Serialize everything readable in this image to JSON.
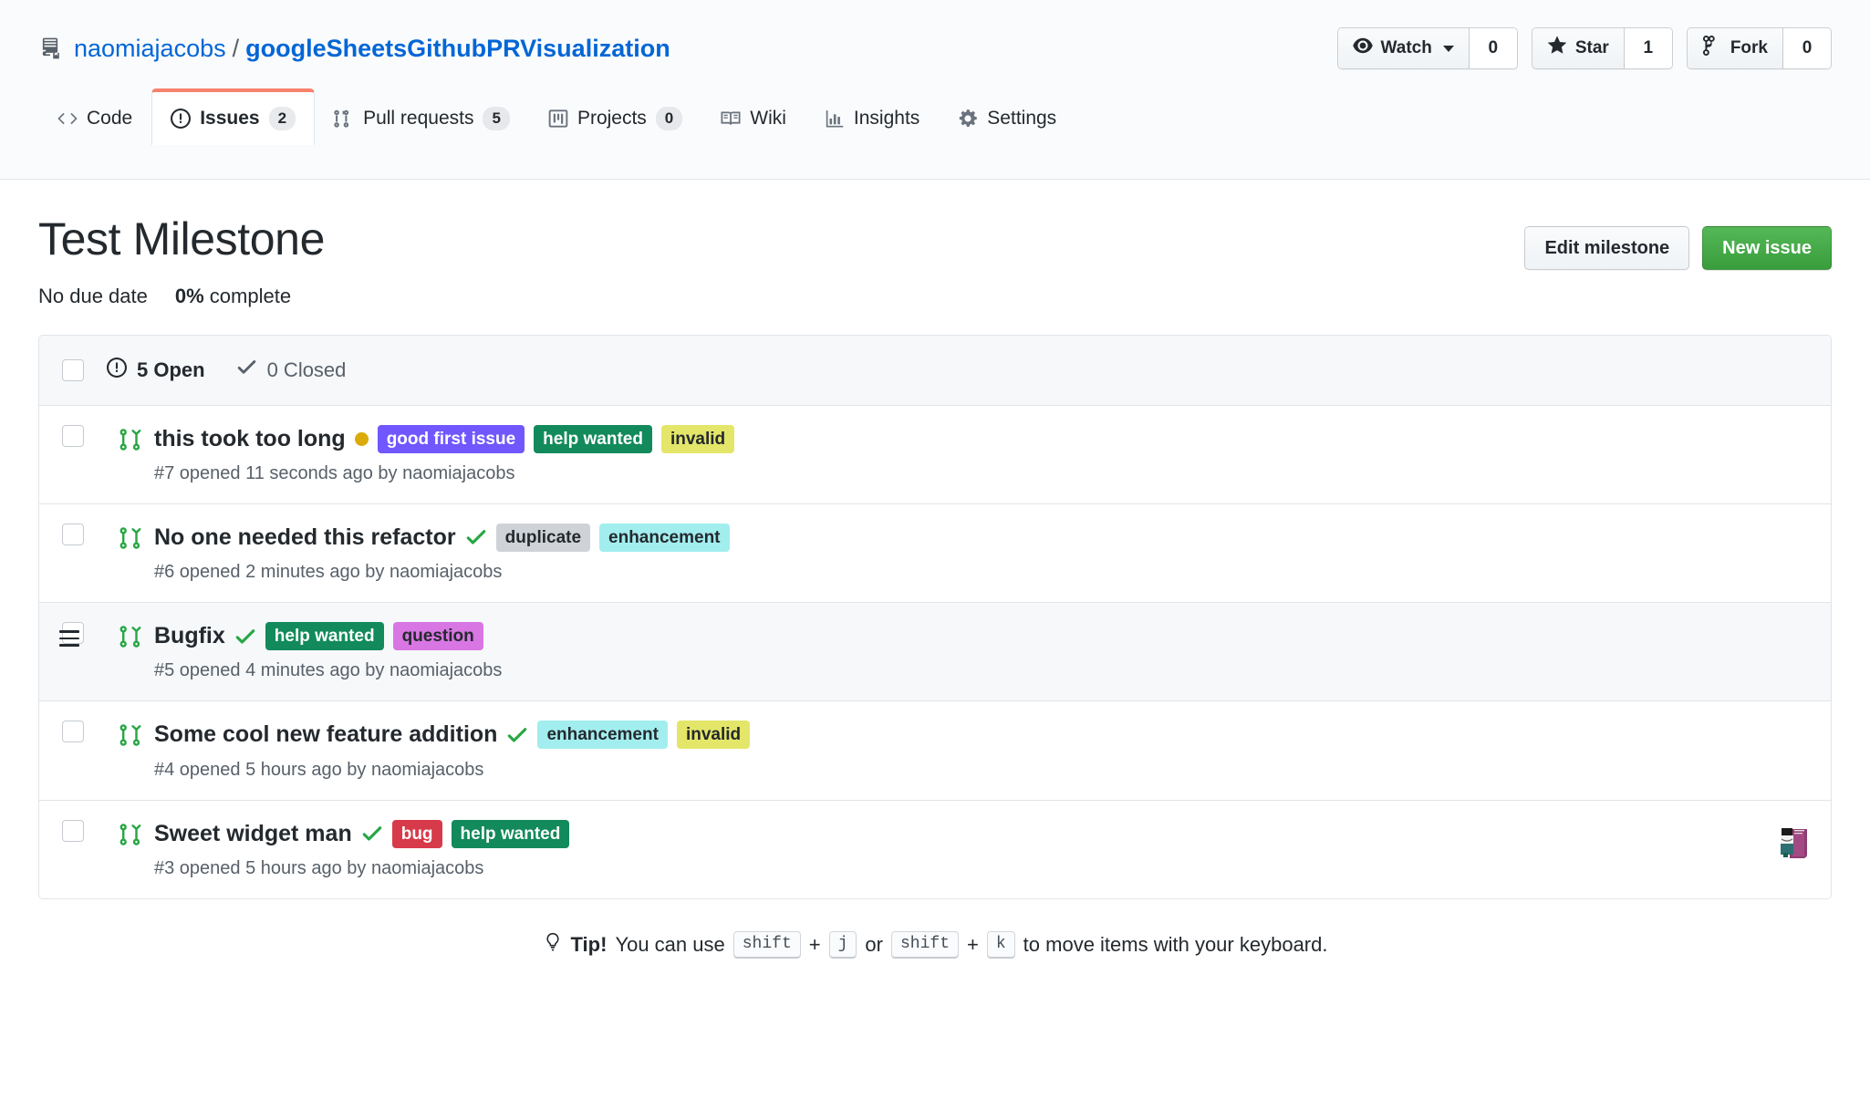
{
  "repo": {
    "owner": "naomiajacobs",
    "name": "googleSheetsGithubPRVisualization",
    "separator": "/",
    "icon": "repo-icon"
  },
  "repo_actions": [
    {
      "label": "Watch",
      "count": "0",
      "icon": "eye-icon",
      "has_caret": true
    },
    {
      "label": "Star",
      "count": "1",
      "icon": "star-icon",
      "has_caret": false
    },
    {
      "label": "Fork",
      "count": "0",
      "icon": "fork-icon",
      "has_caret": false
    }
  ],
  "nav_tabs": [
    {
      "label": "Code",
      "count": null,
      "icon": "code-icon",
      "selected": false
    },
    {
      "label": "Issues",
      "count": "2",
      "icon": "issue-opened-icon",
      "selected": true
    },
    {
      "label": "Pull requests",
      "count": "5",
      "icon": "git-pull-request-icon",
      "selected": false
    },
    {
      "label": "Projects",
      "count": "0",
      "icon": "project-icon",
      "selected": false
    },
    {
      "label": "Wiki",
      "count": null,
      "icon": "book-icon",
      "selected": false
    },
    {
      "label": "Insights",
      "count": null,
      "icon": "graph-icon",
      "selected": false
    },
    {
      "label": "Settings",
      "count": null,
      "icon": "gear-icon",
      "selected": false
    }
  ],
  "milestone": {
    "title": "Test Milestone",
    "due_date": "No due date",
    "percent_complete": "0%",
    "complete_suffix": "complete",
    "edit_button": "Edit milestone",
    "new_issue_button": "New issue"
  },
  "list_header": {
    "open_count": "5 Open",
    "closed_count": "0 Closed",
    "open_icon": "issue-opened-icon",
    "closed_icon": "check-icon"
  },
  "issues": [
    {
      "title": "this took too long",
      "status_marker": "dot",
      "icon": "git-pull-request-icon",
      "meta": "#7 opened 11 seconds ago by naomiajacobs",
      "active": false,
      "has_avatar": false,
      "labels": [
        {
          "name": "good first issue",
          "bg": "#7057ff",
          "fg": "#ffffff"
        },
        {
          "name": "help wanted",
          "bg": "#128a5b",
          "fg": "#ffffff"
        },
        {
          "name": "invalid",
          "bg": "#e4e669",
          "fg": "#24292e"
        }
      ]
    },
    {
      "title": "No one needed this refactor",
      "status_marker": "check",
      "icon": "git-pull-request-icon",
      "meta": "#6 opened 2 minutes ago by naomiajacobs",
      "active": false,
      "has_avatar": false,
      "labels": [
        {
          "name": "duplicate",
          "bg": "#cfd3d7",
          "fg": "#24292e"
        },
        {
          "name": "enhancement",
          "bg": "#a2eeef",
          "fg": "#24292e"
        }
      ]
    },
    {
      "title": "Bugfix",
      "status_marker": "check",
      "icon": "git-pull-request-icon",
      "meta": "#5 opened 4 minutes ago by naomiajacobs",
      "active": true,
      "has_avatar": false,
      "labels": [
        {
          "name": "help wanted",
          "bg": "#128a5b",
          "fg": "#ffffff"
        },
        {
          "name": "question",
          "bg": "#d876e3",
          "fg": "#24292e"
        }
      ]
    },
    {
      "title": "Some cool new feature addition",
      "status_marker": "check",
      "icon": "git-pull-request-icon",
      "meta": "#4 opened 5 hours ago by naomiajacobs",
      "active": false,
      "has_avatar": false,
      "labels": [
        {
          "name": "enhancement",
          "bg": "#a2eeef",
          "fg": "#24292e"
        },
        {
          "name": "invalid",
          "bg": "#e4e669",
          "fg": "#24292e"
        }
      ]
    },
    {
      "title": "Sweet widget man",
      "status_marker": "check",
      "icon": "git-pull-request-icon",
      "meta": "#3 opened 5 hours ago by naomiajacobs",
      "active": false,
      "has_avatar": true,
      "labels": [
        {
          "name": "bug",
          "bg": "#d73a4a",
          "fg": "#ffffff"
        },
        {
          "name": "help wanted",
          "bg": "#128a5b",
          "fg": "#ffffff"
        }
      ]
    }
  ],
  "tip": {
    "icon": "lightbulb-icon",
    "bold": "Tip!",
    "text_1": "You can use",
    "key_1": "shift",
    "plus_1": "+",
    "key_2": "j",
    "or": "or",
    "key_3": "shift",
    "plus_2": "+",
    "key_4": "k",
    "text_2": "to move items with your keyboard."
  },
  "colors": {
    "accent_blue": "#0366d6",
    "tab_active_border": "#f9826c",
    "primary_green": "#2ea44f",
    "open_green": "#28a745",
    "border": "#e1e4e8"
  }
}
